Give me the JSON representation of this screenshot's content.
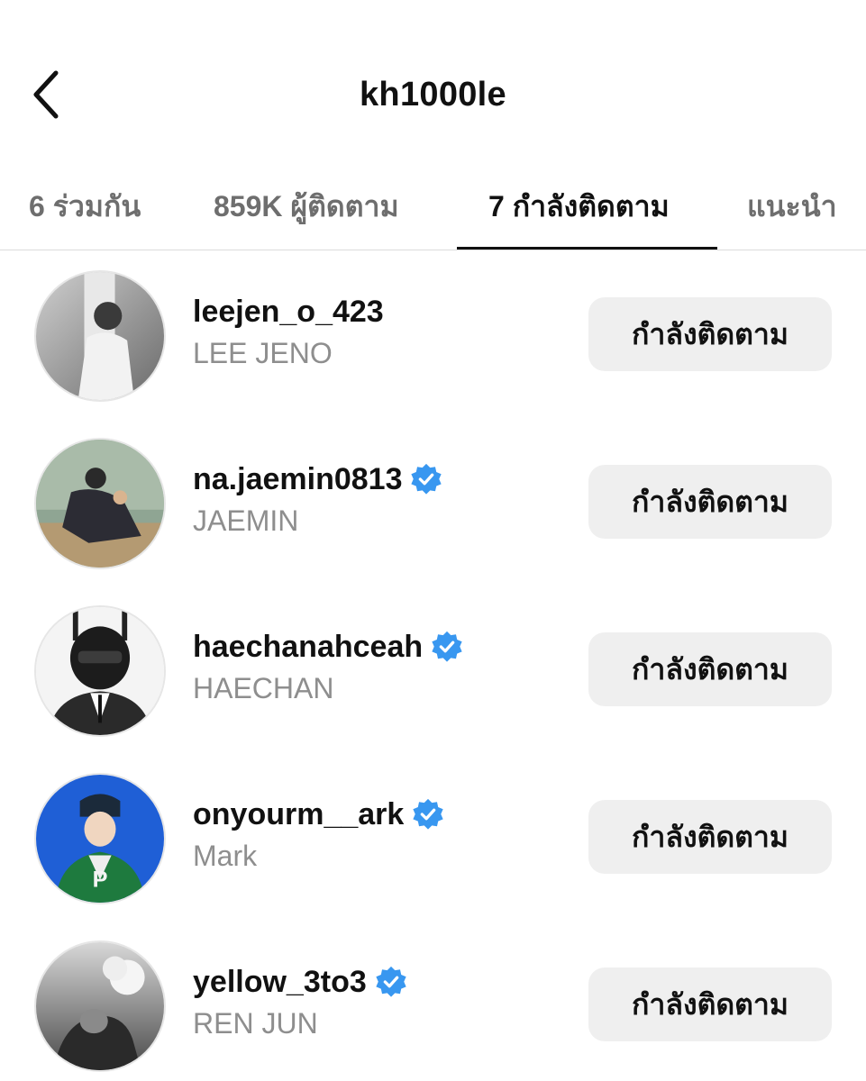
{
  "header": {
    "title": "kh1000le"
  },
  "tabs": [
    {
      "label": "6 ร่วมกัน"
    },
    {
      "label": "859K ผู้ติดตาม"
    },
    {
      "label": "7 กำลังติดตาม"
    },
    {
      "label": "แนะนำ"
    }
  ],
  "active_tab": 2,
  "accounts": [
    {
      "username": "leejen_o_423",
      "fullname": "LEE JENO",
      "verified": false,
      "button_label": "กำลังติดตาม"
    },
    {
      "username": "na.jaemin0813",
      "fullname": "JAEMIN",
      "verified": true,
      "button_label": "กำลังติดตาม"
    },
    {
      "username": "haechanahceah",
      "fullname": "HAECHAN",
      "verified": true,
      "button_label": "กำลังติดตาม"
    },
    {
      "username": "onyourm__ark",
      "fullname": "Mark",
      "verified": true,
      "button_label": "กำลังติดตาม"
    },
    {
      "username": "yellow_3to3",
      "fullname": "REN JUN",
      "verified": true,
      "button_label": "กำลังติดตาม"
    }
  ],
  "colors": {
    "verified_badge": "#3897f0",
    "button_bg": "#efefef",
    "secondary_text": "#8e8e8e"
  }
}
